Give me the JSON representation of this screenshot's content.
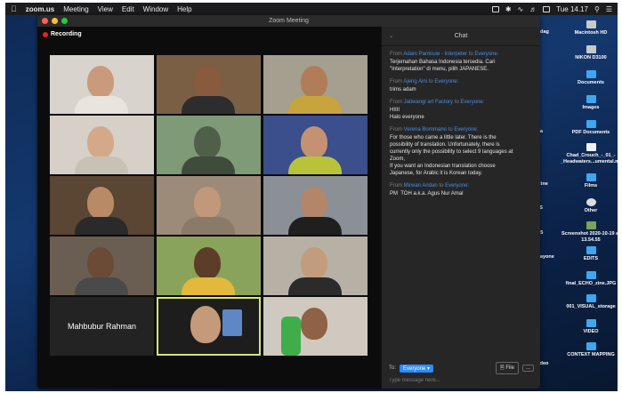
{
  "menubar": {
    "app": "zoom.us",
    "items": [
      "Meeting",
      "View",
      "Edit",
      "Window",
      "Help"
    ],
    "clock": "Tue 14.17"
  },
  "window": {
    "title": "Zoom Meeting"
  },
  "recording": {
    "label": "Recording"
  },
  "participants": {
    "name_tile": "Mahbubur Rahman"
  },
  "chat": {
    "title": "Chat",
    "messages": [
      {
        "from": "Adam Pantouw - Interpeter",
        "to": "Everyone",
        "lines": [
          "Terjemahan Bahasa Indonesia tersedia. Cari",
          "\"Interpretation\" di menu, pilih JAPANESE."
        ]
      },
      {
        "from": "Ajeng Aini",
        "to": "Everyone",
        "lines": [
          "trims adam"
        ]
      },
      {
        "from": "Jatiwangi  art Factory",
        "to": "Everyone",
        "lines": [
          "HIIII",
          "Halo everyone"
        ]
      },
      {
        "from": "Verena Bornmann",
        "to": "Everyone",
        "lines": [
          "For those who came a little later. There is the",
          "possibility of translation. Unfortunately, there is",
          "currently only the possibility to select 9 languages at",
          "Zoom,",
          "If you want an Indonesian translation choose",
          "Japanese, for Arabic it is Korean today."
        ]
      },
      {
        "from": "Mirwan Andan",
        "to": "Everyone",
        "lines": [
          "PM  TOH a.k.a. Agus Nur Amal"
        ]
      }
    ],
    "from_word": "From",
    "to_word": "to",
    "footer": {
      "to_label": "To:",
      "recipient": "Everyone",
      "file_label": "File",
      "more_label": "...",
      "placeholder": "Type message here..."
    }
  },
  "desktop": {
    "icons": [
      "Macintosh HD",
      "NIKON D3100",
      "Documents",
      "Images",
      "PDF Documents",
      "Chad_Crouch_-_01_-_Headwaters...umental.mp3",
      "Films",
      "Other",
      "Screenshot 2020-10-19 at 13.54.55",
      "EDITS",
      "final_ECHO_zine.JPG",
      "001_VISUAL_storage",
      "VIDEO",
      "CONTEXT MAPPING"
    ],
    "left_labels": [
      "adag",
      "ula",
      "f3",
      "_zine",
      "OS",
      "r15",
      "idayone",
      "video"
    ]
  }
}
